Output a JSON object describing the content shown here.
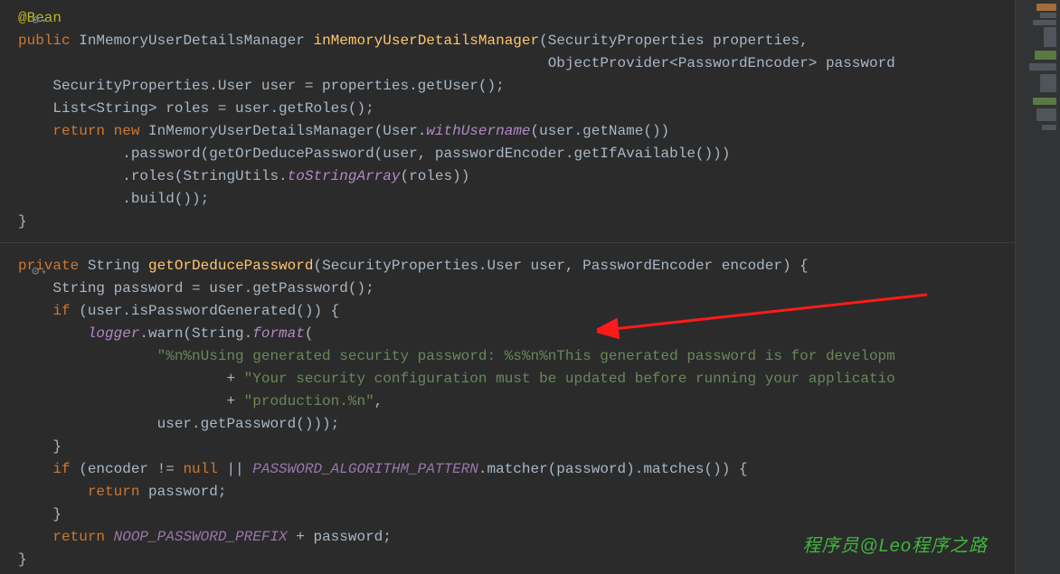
{
  "watermark": "程序员@Leo程序之路",
  "block1": {
    "annot": "@Bean",
    "l1_kw1": "public",
    "l1_type1": "InMemoryUserDetailsManager",
    "l1_fn": "inMemoryUserDetailsManager",
    "l1_p1": "(SecurityProperties properties,",
    "l2": "ObjectProvider<PasswordEncoder> password",
    "l3_a": "SecurityProperties.User user = properties.getUser();",
    "l4_a": "List<String> roles = user.getRoles();",
    "l5_kw1": "return",
    "l5_kw2": "new",
    "l5_type": "InMemoryUserDetailsManager",
    "l5_rest1": "(User.",
    "l5_ital": "withUsername",
    "l5_rest2": "(user.getName())",
    "l6": ".password(getOrDeducePassword(user, passwordEncoder.getIfAvailable()))",
    "l7_a": ".roles(StringUtils.",
    "l7_ital": "toStringArray",
    "l7_b": "(roles))",
    "l8": ".build());",
    "close": "}"
  },
  "block2": {
    "l1_kw": "private",
    "l1_type": "String",
    "l1_fn": "getOrDeducePassword",
    "l1_params": "(SecurityProperties.User user, PasswordEncoder encoder) {",
    "l2": "String password = user.getPassword();",
    "l3_kw": "if",
    "l3_rest": "(user.isPasswordGenerated()) {",
    "l4_ital": "logger",
    "l4_a": ".warn(String.",
    "l4_ital2": "format",
    "l4_b": "(",
    "l5_str": "\"%n%nUsing generated security password: %s%n%nThis generated password is for developm",
    "l6_op": "+ ",
    "l6_str": "\"Your security configuration must be updated before running your applicatio",
    "l7_op": "+ ",
    "l7_str": "\"production.%n\"",
    "l7_end": ",",
    "l8": "user.getPassword()));",
    "l9": "}",
    "l10_kw": "if",
    "l10_a": "(encoder != ",
    "l10_null": "null",
    "l10_b": " || ",
    "l10_const": "PASSWORD_ALGORITHM_PATTERN",
    "l10_c": ".matcher(password).matches()) {",
    "l11_kw": "return",
    "l11_rest": "password;",
    "l12": "}",
    "l13_kw": "return",
    "l13_const": "NOOP_PASSWORD_PREFIX",
    "l13_rest": " + password;",
    "close": "}"
  }
}
